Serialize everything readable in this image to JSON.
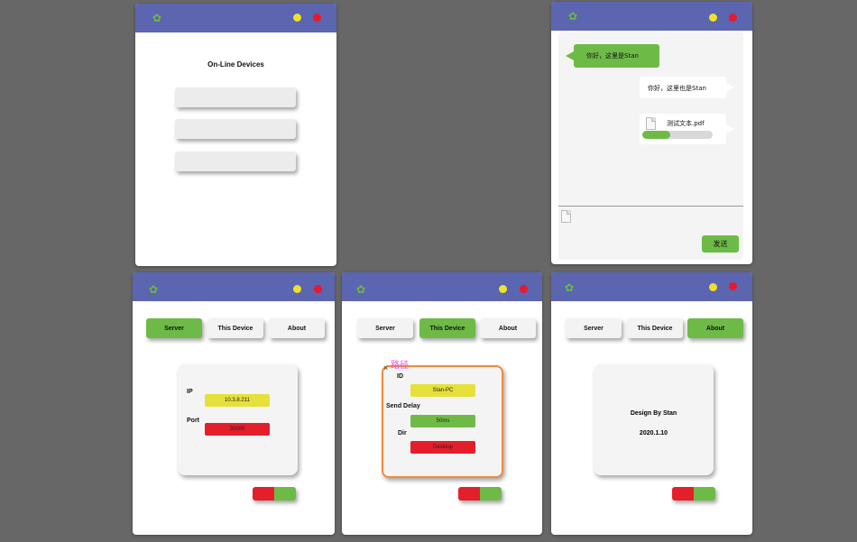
{
  "colors": {
    "titlebar": "#5b65b0",
    "green": "#6dbb46",
    "yellow": "#e6e03b",
    "red": "#e51e2b",
    "background": "#676767"
  },
  "icons": [
    "gear-icon",
    "file-icon"
  ],
  "online": {
    "title": "On-Line Devices"
  },
  "chat": {
    "msg_in": "你好，这里是Stan",
    "msg_out": "你好，这里也是Stan",
    "file_name": "测试文本.pdf",
    "file_progress": 0.4,
    "send_label": "发送"
  },
  "tabs": {
    "server": "Server",
    "this_device": "This Device",
    "about": "About"
  },
  "server_panel": {
    "ip_label": "IP",
    "ip_value": "10.3.8.211",
    "port_label": "Port",
    "port_value": "30000"
  },
  "device_panel": {
    "path_label": "路径",
    "close_mark": "×",
    "id_label": "ID",
    "id_value": "Stan-PC",
    "delay_label": "Send Delay",
    "delay_value": "50ms",
    "dir_label": "Dir",
    "dir_value": "Desktop"
  },
  "about_panel": {
    "credit": "Design By Stan",
    "date": "2020.1.10"
  }
}
